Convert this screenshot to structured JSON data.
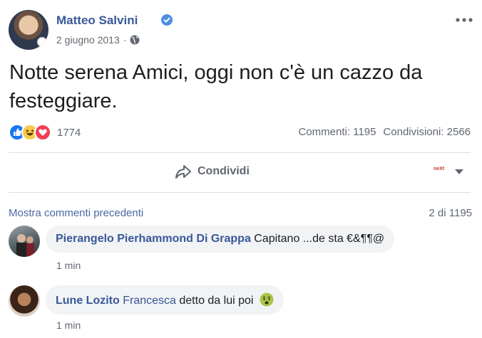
{
  "post": {
    "author": "Matteo Salvini",
    "date": "2 giugno 2013",
    "separator": "·",
    "text": "Notte serena Amici, oggi non c'è un cazzo da festeggiare.",
    "reaction_count": "1774",
    "comments_label": "Commenti: 1195",
    "shares_label": "Condivisioni: 2566",
    "share_button_label": "Condividi",
    "audience_badge": "neXt"
  },
  "comments": {
    "show_previous_label": "Mostra commenti precedenti",
    "page_count": "2 di 1195",
    "items": [
      {
        "name": "Pierangelo Pierhammond Di Grappa",
        "mention": "",
        "text": "Capitano ...de sta €&¶¶@",
        "time": "1 min"
      },
      {
        "name": "Lune Lozito",
        "mention": "Francesca",
        "text": "detto da lui poi",
        "time": "1 min"
      }
    ]
  },
  "colors": {
    "link_blue": "#385898",
    "secondary_text": "#606770",
    "like_blue": "#1877f2",
    "haha_yellow": "#f7c94c",
    "love_red": "#f33e58"
  },
  "icons": [
    "verified-icon",
    "globe-icon",
    "more-icon",
    "like-reaction-icon",
    "haha-reaction-icon",
    "love-reaction-icon",
    "share-icon",
    "caret-down-icon",
    "sick-emoji-icon"
  ]
}
